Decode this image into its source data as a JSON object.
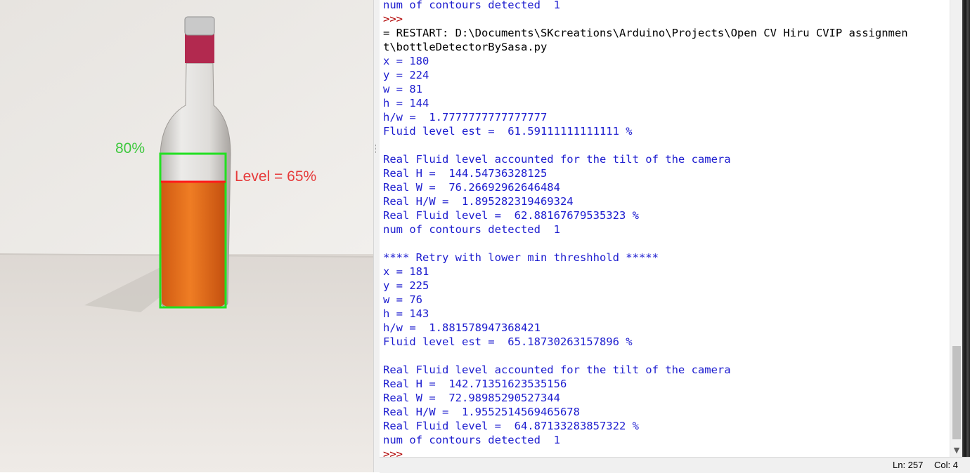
{
  "camera_view": {
    "target_label": "80%",
    "level_label": "Level = 65%"
  },
  "shell": {
    "lines": [
      {
        "text": "num of contours detected  1",
        "kind": "output"
      },
      {
        "text": ">>>",
        "kind": "prompt"
      },
      {
        "text": "= RESTART: D:\\Documents\\SKcreations\\Arduino\\Projects\\Open CV Hiru CVIP assignmen",
        "kind": "restart"
      },
      {
        "text": "t\\bottleDetectorBySasa.py",
        "kind": "restart"
      },
      {
        "text": "x = 180",
        "kind": "output"
      },
      {
        "text": "y = 224",
        "kind": "output"
      },
      {
        "text": "w = 81",
        "kind": "output"
      },
      {
        "text": "h = 144",
        "kind": "output"
      },
      {
        "text": "h/w =  1.7777777777777777",
        "kind": "output"
      },
      {
        "text": "Fluid level est =  61.59111111111111 %",
        "kind": "output"
      },
      {
        "text": "",
        "kind": "output"
      },
      {
        "text": "Real Fluid level accounted for the tilt of the camera",
        "kind": "output"
      },
      {
        "text": "Real H =  144.54736328125",
        "kind": "output"
      },
      {
        "text": "Real W =  76.26692962646484",
        "kind": "output"
      },
      {
        "text": "Real H/W =  1.895282319469324",
        "kind": "output"
      },
      {
        "text": "Real Fluid level =  62.88167679535323 %",
        "kind": "output"
      },
      {
        "text": "num of contours detected  1",
        "kind": "output"
      },
      {
        "text": "",
        "kind": "output"
      },
      {
        "text": "**** Retry with lower min threshhold *****",
        "kind": "output"
      },
      {
        "text": "x = 181",
        "kind": "output"
      },
      {
        "text": "y = 225",
        "kind": "output"
      },
      {
        "text": "w = 76",
        "kind": "output"
      },
      {
        "text": "h = 143",
        "kind": "output"
      },
      {
        "text": "h/w =  1.881578947368421",
        "kind": "output"
      },
      {
        "text": "Fluid level est =  65.18730263157896 %",
        "kind": "output"
      },
      {
        "text": "",
        "kind": "output"
      },
      {
        "text": "Real Fluid level accounted for the tilt of the camera",
        "kind": "output"
      },
      {
        "text": "Real H =  142.71351623535156",
        "kind": "output"
      },
      {
        "text": "Real W =  72.98985290527344",
        "kind": "output"
      },
      {
        "text": "Real H/W =  1.9552514569465678",
        "kind": "output"
      },
      {
        "text": "Real Fluid level =  64.87133283857322 %",
        "kind": "output"
      },
      {
        "text": "num of contours detected  1",
        "kind": "output"
      },
      {
        "text": ">>>",
        "kind": "prompt"
      }
    ]
  },
  "statusbar": {
    "line": "Ln: 257",
    "column": "Col: 4"
  },
  "colors": {
    "output_text": "#1c1ccf",
    "prompt_text": "#b00000",
    "detection_box": "#22e022",
    "level_marker": "#ff1a1a",
    "fluid": "#e8741f"
  },
  "scroll": {
    "position_fraction": 0.95
  }
}
